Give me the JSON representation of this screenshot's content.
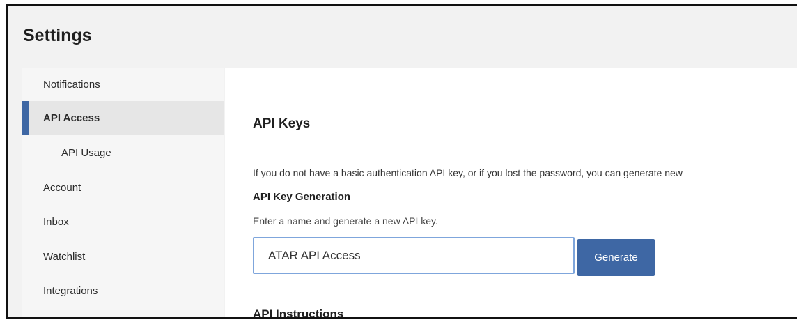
{
  "header": {
    "title": "Settings"
  },
  "sidebar": {
    "items": [
      {
        "label": "Notifications"
      },
      {
        "label": "API Access"
      },
      {
        "label": "API Usage"
      },
      {
        "label": "Account"
      },
      {
        "label": "Inbox"
      },
      {
        "label": "Watchlist"
      },
      {
        "label": "Integrations"
      }
    ],
    "active_index": 1
  },
  "main": {
    "section_title": "API Keys",
    "description": "If you do not have a basic authentication API key, or if you lost the password, you can generate new",
    "generation_heading": "API Key Generation",
    "generation_hint": "Enter a name and generate a new API key.",
    "name_input_value": "ATAR API Access",
    "generate_label": "Generate",
    "instructions_heading": "API Instructions"
  },
  "colors": {
    "accent": "#3e67a4",
    "input_border": "#7fa6dc",
    "header_bg": "#f2f2f2"
  }
}
